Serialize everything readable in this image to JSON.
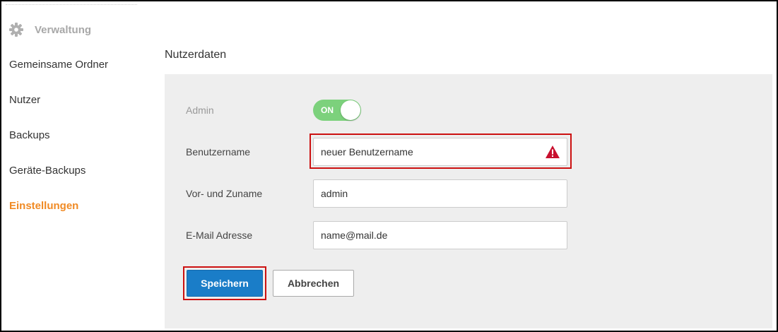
{
  "sidebar": {
    "header": {
      "label": "Verwaltung",
      "icon": "gear-icon"
    },
    "items": [
      {
        "label": "Gemeinsame Ordner",
        "active": false
      },
      {
        "label": "Nutzer",
        "active": false
      },
      {
        "label": "Backups",
        "active": false
      },
      {
        "label": "Geräte-Backups",
        "active": false
      },
      {
        "label": "Einstellungen",
        "active": true
      }
    ]
  },
  "main": {
    "title": "Nutzerdaten",
    "form": {
      "admin": {
        "label": "Admin",
        "toggle_text": "ON",
        "on": true
      },
      "username": {
        "label": "Benutzername",
        "value": "neuer Benutzername",
        "icon": "warning-icon"
      },
      "fullname": {
        "label": "Vor- und Zuname",
        "value": "admin"
      },
      "email": {
        "label": "E-Mail Adresse",
        "value": "name@mail.de"
      }
    },
    "buttons": {
      "save": "Speichern",
      "cancel": "Abbrechen"
    }
  },
  "colors": {
    "accent": "#f08a24",
    "primary_button": "#1a7dc8",
    "toggle_on": "#7cd17c",
    "highlight": "#cc1111",
    "panel": "#eeeeee"
  }
}
